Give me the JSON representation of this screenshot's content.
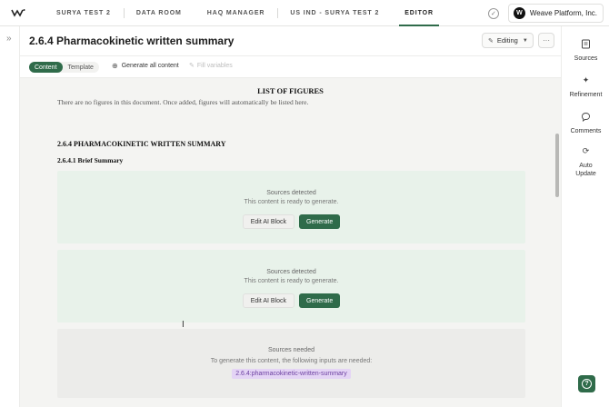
{
  "nav": {
    "tabs": [
      {
        "label": "SURYA TEST 2"
      },
      {
        "label": "DATA ROOM"
      },
      {
        "label": "HAQ MANAGER"
      },
      {
        "label": "US IND - SURYA TEST 2"
      },
      {
        "label": "EDITOR"
      }
    ],
    "active_tab": "EDITOR",
    "org_name": "Weave Platform, Inc.",
    "org_initial": "W",
    "check_glyph": "✓"
  },
  "header": {
    "title": "2.6.4 Pharmacokinetic written summary",
    "mode_label": "Editing",
    "more_glyph": "···"
  },
  "toolbar": {
    "content_label": "Content",
    "template_label": "Template",
    "generate_all_label": "Generate all content",
    "fill_variables_label": "Fill variables"
  },
  "document": {
    "lof_title": "LIST OF FIGURES",
    "lof_text": "There are no figures in this document. Once added, figures will automatically be listed here.",
    "heading1": "2.6.4 PHARMACOKINETIC WRITTEN SUMMARY",
    "heading2": "2.6.4.1 Brief Summary",
    "blocks": [
      {
        "title": "Sources detected",
        "subtitle": "This content is ready to generate.",
        "edit_label": "Edit AI Block",
        "generate_label": "Generate"
      },
      {
        "title": "Sources detected",
        "subtitle": "This content is ready to generate.",
        "edit_label": "Edit AI Block",
        "generate_label": "Generate"
      },
      {
        "title": "Sources needed",
        "subtitle": "To generate this content, the following inputs are needed:",
        "input_tag": "2.6.4:pharmacokinetic-written-summary"
      }
    ]
  },
  "sidebar": {
    "items": [
      {
        "label": "Sources",
        "icon": "sources-icon"
      },
      {
        "label": "Refinement",
        "icon": "sparkle-icon"
      },
      {
        "label": "Comments",
        "icon": "comment-icon"
      },
      {
        "label": "Auto Update",
        "icon": "refresh-icon"
      }
    ],
    "help_glyph": "?"
  },
  "colors": {
    "accent": "#2f6b4a",
    "ready_block": "#e8f2ea",
    "needed_block": "#ececea",
    "tag_bg": "#e4d4f5",
    "tag_text": "#6b3fa0"
  }
}
